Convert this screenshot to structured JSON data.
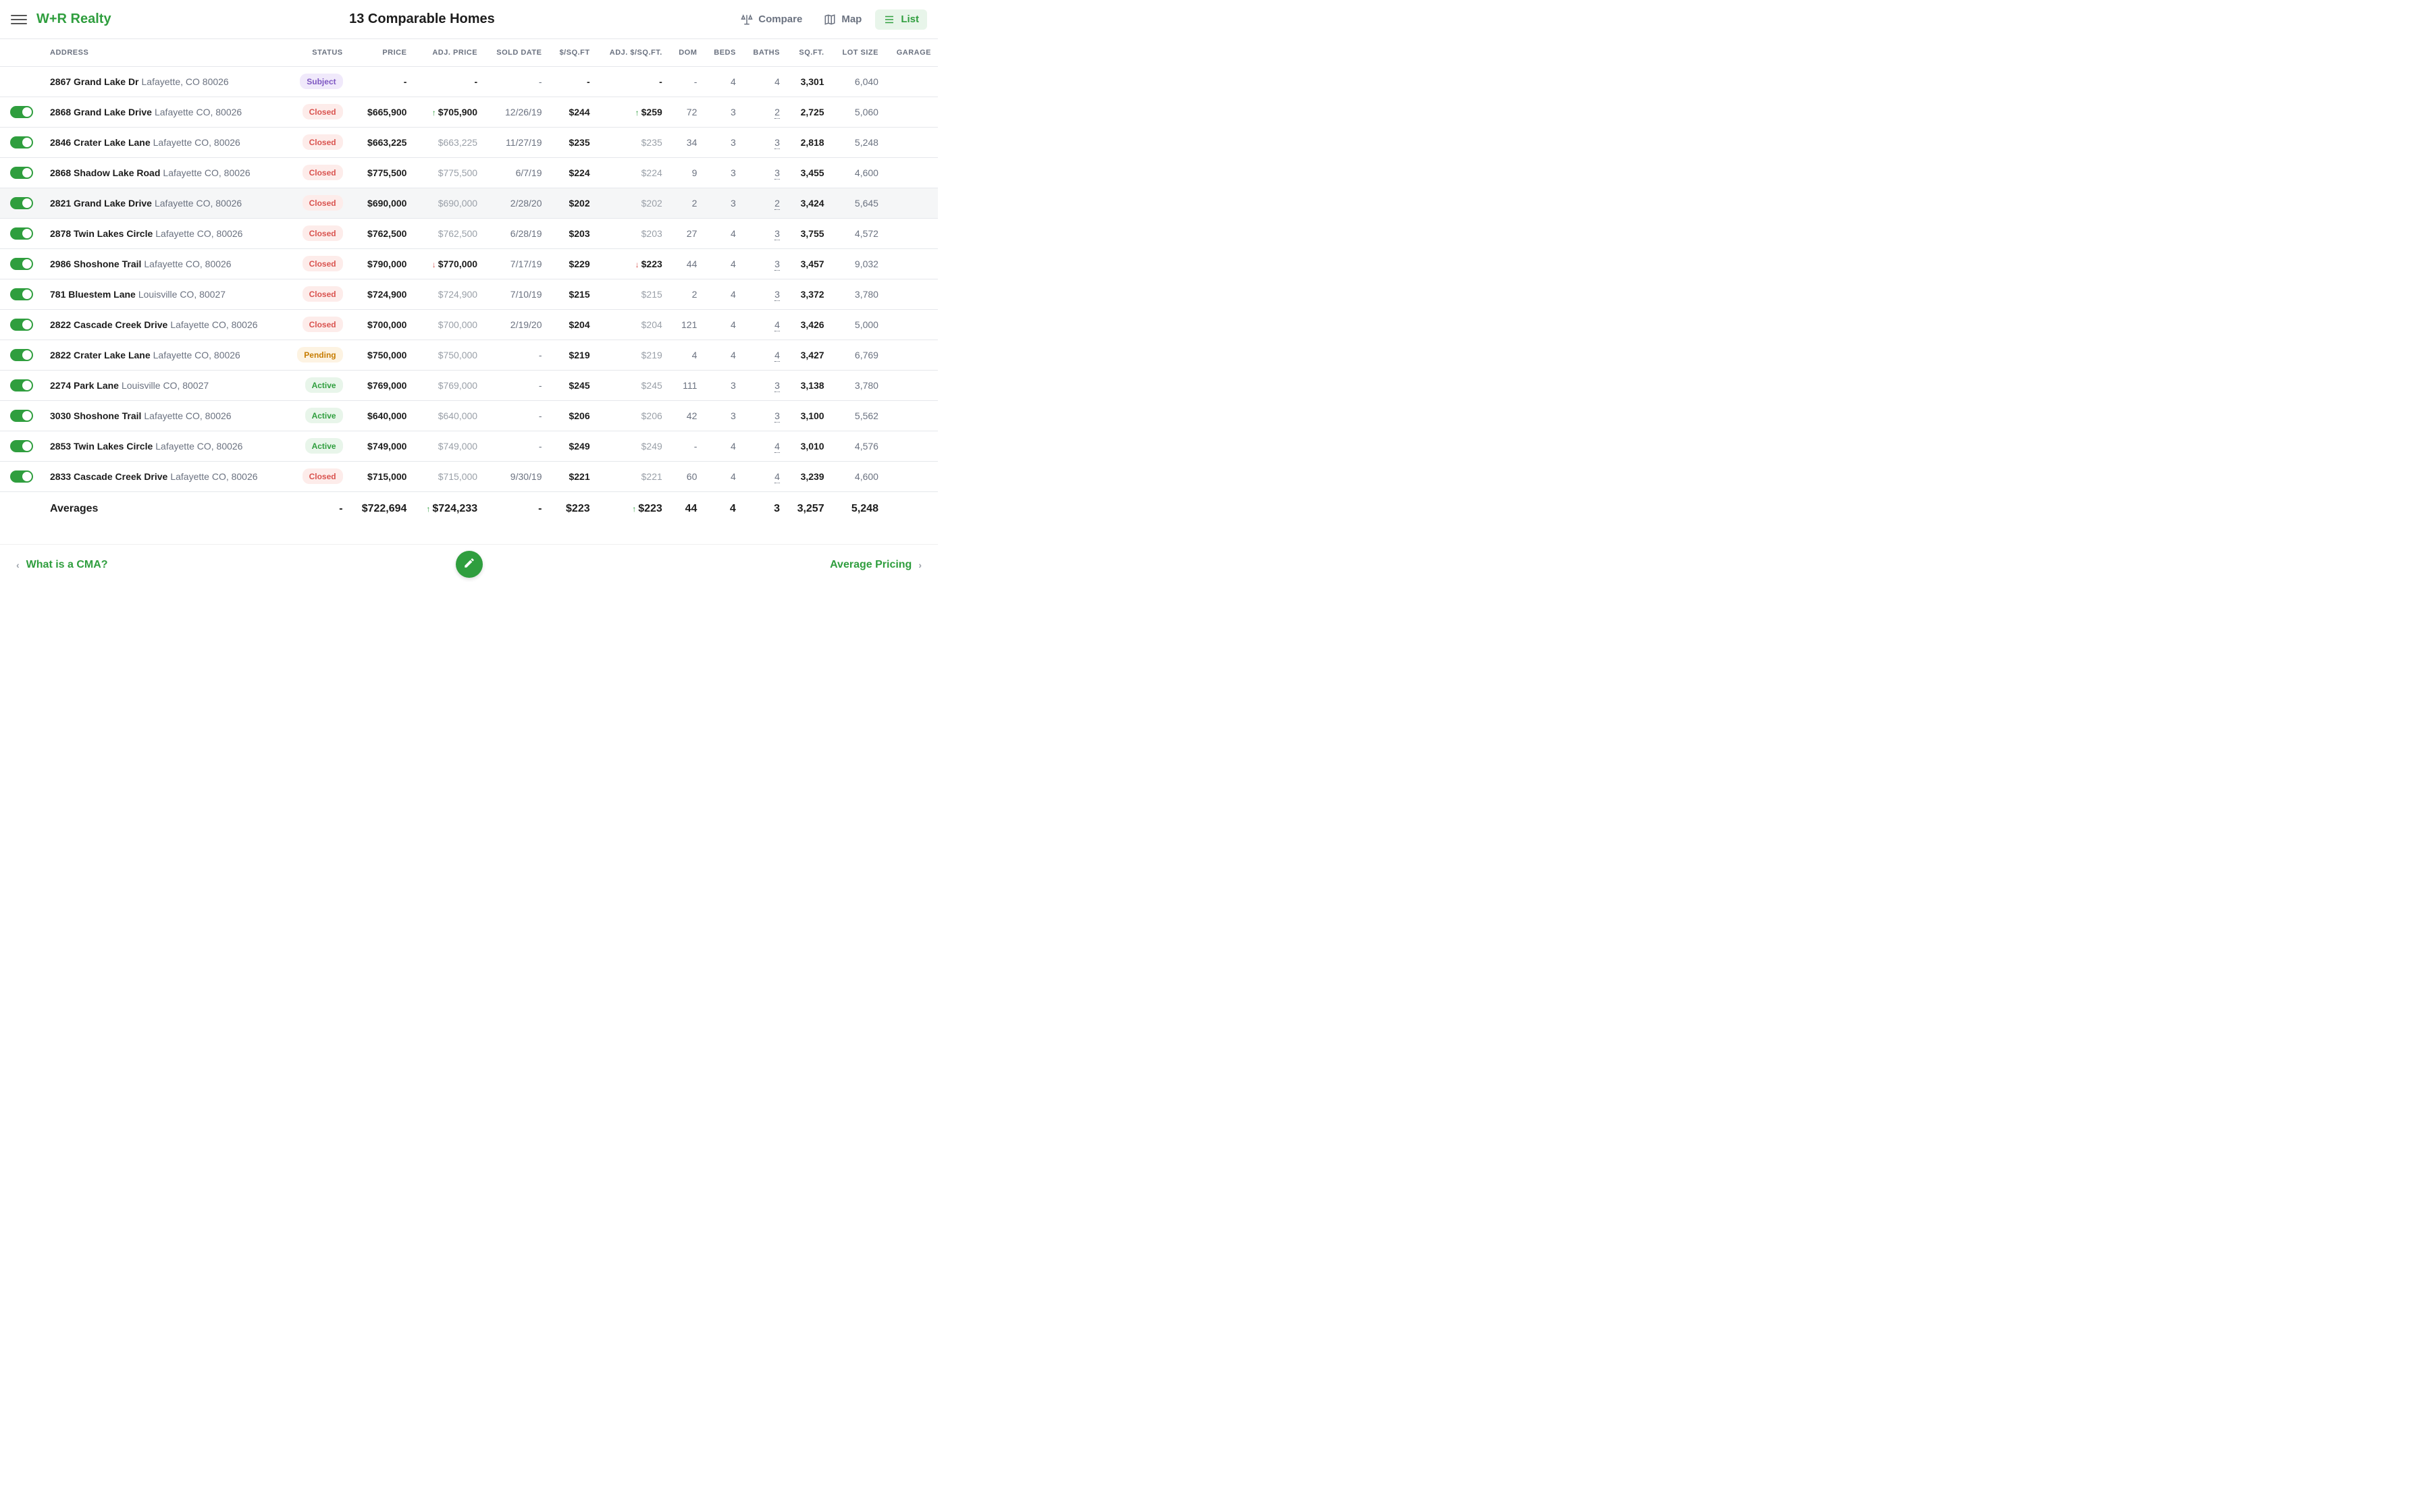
{
  "header": {
    "logo": "W+R Realty",
    "title": "13 Comparable Homes",
    "actions": {
      "compare": "Compare",
      "map": "Map",
      "list": "List"
    }
  },
  "columns": {
    "address": "ADDRESS",
    "status": "STATUS",
    "price": "PRICE",
    "adj_price": "ADJ. PRICE",
    "sold_date": "SOLD DATE",
    "psf": "$/SQ.FT",
    "adj_psf": "ADJ. $/SQ.FT.",
    "dom": "DOM",
    "beds": "BEDS",
    "baths": "BATHS",
    "sqft": "SQ.FT.",
    "lot": "LOT SIZE",
    "garage": "GARAGE"
  },
  "status_labels": {
    "subject": "Subject",
    "closed": "Closed",
    "pending": "Pending",
    "active": "Active"
  },
  "rows": [
    {
      "subject": true,
      "street": "2867 Grand Lake Dr",
      "city": "Lafayette, CO 80026",
      "status": "subject",
      "price": "-",
      "adj_price": "-",
      "sold_date": "-",
      "psf": "-",
      "adj_psf": "-",
      "dom": "-",
      "beds": "4",
      "baths": "4",
      "sqft": "3,301",
      "lot": "6,040"
    },
    {
      "street": "2868 Grand Lake Drive",
      "city": "Lafayette CO, 80026",
      "status": "closed",
      "price": "$665,900",
      "adj_price": "$705,900",
      "adj_price_dir": "up",
      "sold_date": "12/26/19",
      "psf": "$244",
      "adj_psf": "$259",
      "adj_psf_dir": "up",
      "dom": "72",
      "beds": "3",
      "baths": "2",
      "baths_u": true,
      "sqft": "2,725",
      "lot": "5,060"
    },
    {
      "street": "2846 Crater Lake Lane",
      "city": "Lafayette CO, 80026",
      "status": "closed",
      "price": "$663,225",
      "adj_price": "$663,225",
      "adj_light": true,
      "sold_date": "11/27/19",
      "psf": "$235",
      "adj_psf": "$235",
      "adj_psf_light": true,
      "dom": "34",
      "beds": "3",
      "baths": "3",
      "baths_u": true,
      "sqft": "2,818",
      "lot": "5,248"
    },
    {
      "street": "2868 Shadow Lake Road",
      "city": "Lafayette CO, 80026",
      "status": "closed",
      "price": "$775,500",
      "adj_price": "$775,500",
      "adj_light": true,
      "sold_date": "6/7/19",
      "psf": "$224",
      "adj_psf": "$224",
      "adj_psf_light": true,
      "dom": "9",
      "beds": "3",
      "baths": "3",
      "baths_u": true,
      "sqft": "3,455",
      "lot": "4,600"
    },
    {
      "street": "2821 Grand Lake Drive",
      "city": "Lafayette CO, 80026",
      "status": "closed",
      "price": "$690,000",
      "adj_price": "$690,000",
      "adj_light": true,
      "sold_date": "2/28/20",
      "psf": "$202",
      "adj_psf": "$202",
      "adj_psf_light": true,
      "dom": "2",
      "beds": "3",
      "baths": "2",
      "baths_u": true,
      "sqft": "3,424",
      "lot": "5,645",
      "hover": true
    },
    {
      "street": "2878 Twin Lakes Circle",
      "city": "Lafayette CO, 80026",
      "status": "closed",
      "price": "$762,500",
      "adj_price": "$762,500",
      "adj_light": true,
      "sold_date": "6/28/19",
      "psf": "$203",
      "adj_psf": "$203",
      "adj_psf_light": true,
      "dom": "27",
      "beds": "4",
      "baths": "3",
      "baths_u": true,
      "sqft": "3,755",
      "lot": "4,572"
    },
    {
      "street": "2986 Shoshone Trail",
      "city": "Lafayette CO, 80026",
      "status": "closed",
      "price": "$790,000",
      "adj_price": "$770,000",
      "adj_price_dir": "down",
      "sold_date": "7/17/19",
      "psf": "$229",
      "adj_psf": "$223",
      "adj_psf_dir": "down",
      "dom": "44",
      "beds": "4",
      "baths": "3",
      "baths_u": true,
      "sqft": "3,457",
      "lot": "9,032"
    },
    {
      "street": "781 Bluestem Lane",
      "city": "Louisville CO, 80027",
      "status": "closed",
      "price": "$724,900",
      "adj_price": "$724,900",
      "adj_light": true,
      "sold_date": "7/10/19",
      "psf": "$215",
      "adj_psf": "$215",
      "adj_psf_light": true,
      "dom": "2",
      "beds": "4",
      "baths": "3",
      "baths_u": true,
      "sqft": "3,372",
      "lot": "3,780"
    },
    {
      "street": "2822 Cascade Creek Drive",
      "city": "Lafayette CO, 80026",
      "status": "closed",
      "price": "$700,000",
      "adj_price": "$700,000",
      "adj_light": true,
      "sold_date": "2/19/20",
      "psf": "$204",
      "adj_psf": "$204",
      "adj_psf_light": true,
      "dom": "121",
      "beds": "4",
      "baths": "4",
      "baths_u": true,
      "sqft": "3,426",
      "lot": "5,000"
    },
    {
      "street": "2822 Crater Lake Lane",
      "city": "Lafayette CO, 80026",
      "status": "pending",
      "price": "$750,000",
      "adj_price": "$750,000",
      "adj_light": true,
      "sold_date": "-",
      "psf": "$219",
      "adj_psf": "$219",
      "adj_psf_light": true,
      "dom": "4",
      "beds": "4",
      "baths": "4",
      "baths_u": true,
      "sqft": "3,427",
      "lot": "6,769"
    },
    {
      "street": "2274 Park Lane",
      "city": "Louisville CO, 80027",
      "status": "active",
      "price": "$769,000",
      "adj_price": "$769,000",
      "adj_light": true,
      "sold_date": "-",
      "psf": "$245",
      "adj_psf": "$245",
      "adj_psf_light": true,
      "dom": "111",
      "beds": "3",
      "baths": "3",
      "baths_u": true,
      "sqft": "3,138",
      "lot": "3,780"
    },
    {
      "street": "3030 Shoshone Trail",
      "city": "Lafayette CO, 80026",
      "status": "active",
      "price": "$640,000",
      "adj_price": "$640,000",
      "adj_light": true,
      "sold_date": "-",
      "psf": "$206",
      "adj_psf": "$206",
      "adj_psf_light": true,
      "dom": "42",
      "beds": "3",
      "baths": "3",
      "baths_u": true,
      "sqft": "3,100",
      "lot": "5,562"
    },
    {
      "street": "2853 Twin Lakes Circle",
      "city": "Lafayette CO, 80026",
      "status": "active",
      "price": "$749,000",
      "adj_price": "$749,000",
      "adj_light": true,
      "sold_date": "-",
      "psf": "$249",
      "adj_psf": "$249",
      "adj_psf_light": true,
      "dom": "-",
      "beds": "4",
      "baths": "4",
      "baths_u": true,
      "sqft": "3,010",
      "lot": "4,576"
    },
    {
      "street": "2833 Cascade Creek Drive",
      "city": "Lafayette CO, 80026",
      "status": "closed",
      "price": "$715,000",
      "adj_price": "$715,000",
      "adj_light": true,
      "sold_date": "9/30/19",
      "psf": "$221",
      "adj_psf": "$221",
      "adj_psf_light": true,
      "dom": "60",
      "beds": "4",
      "baths": "4",
      "baths_u": true,
      "sqft": "3,239",
      "lot": "4,600"
    }
  ],
  "averages": {
    "label": "Averages",
    "status": "-",
    "price": "$722,694",
    "adj_price": "$724,233",
    "adj_price_dir": "up",
    "sold_date": "-",
    "psf": "$223",
    "adj_psf": "$223",
    "adj_psf_dir": "up",
    "dom": "44",
    "beds": "4",
    "baths": "3",
    "sqft": "3,257",
    "lot": "5,248"
  },
  "footer": {
    "prev": "What is a CMA?",
    "next": "Average Pricing"
  }
}
